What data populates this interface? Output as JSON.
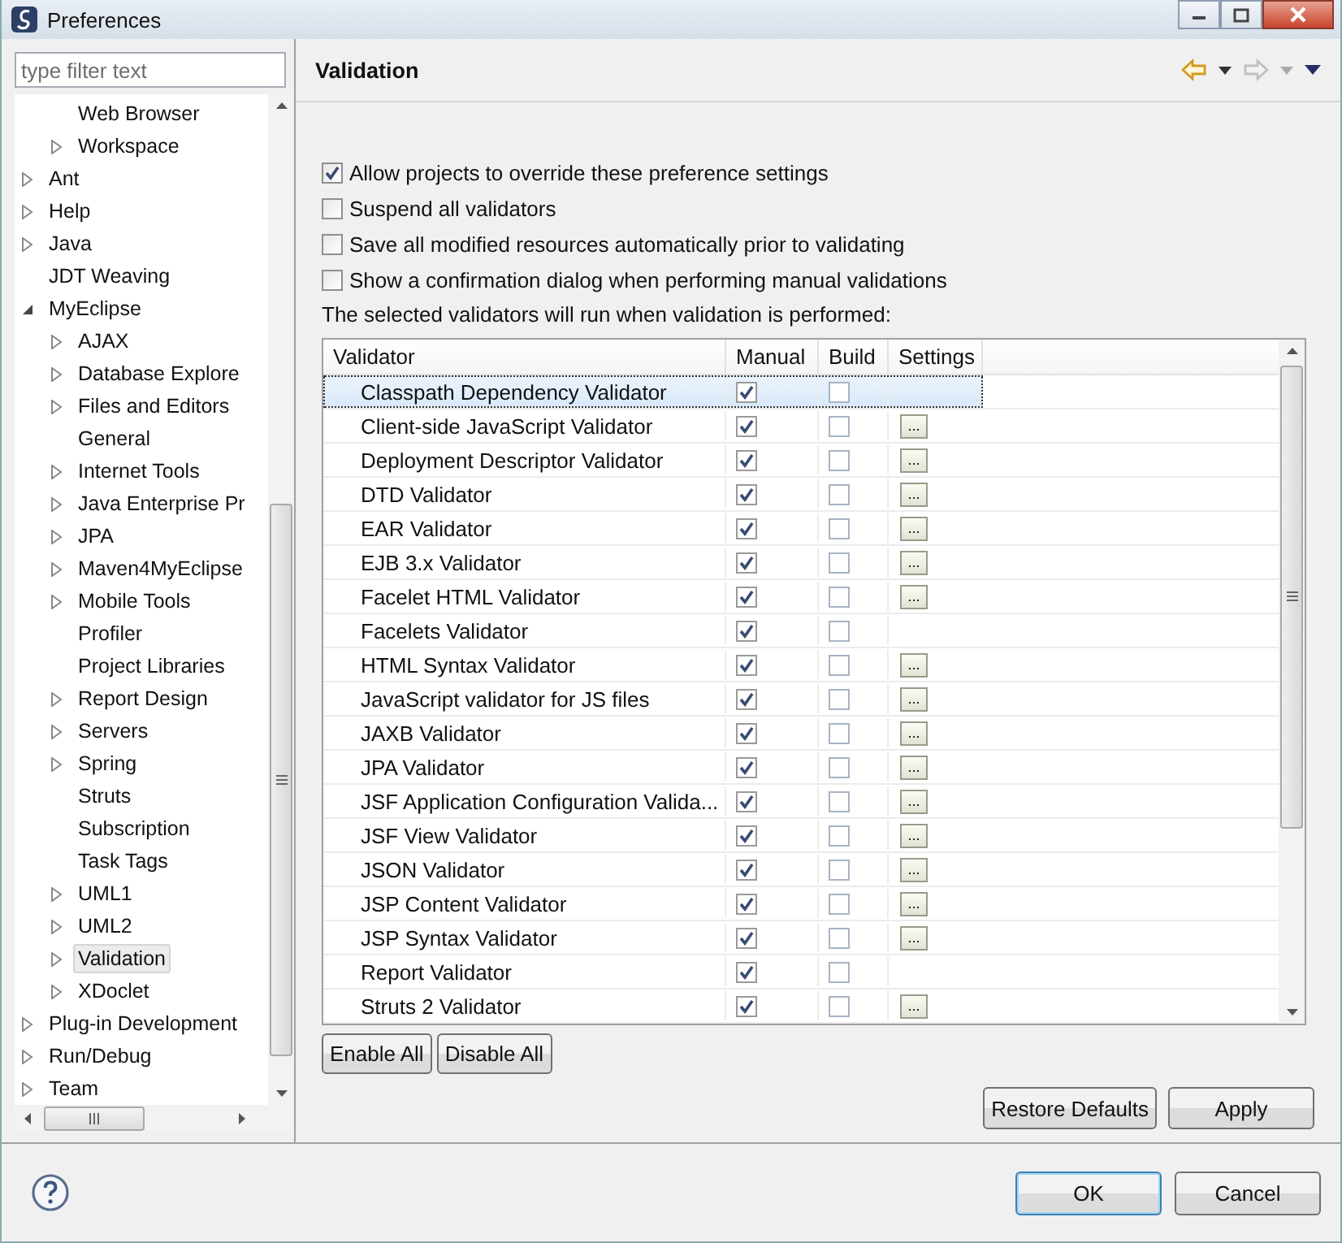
{
  "window": {
    "title": "Preferences"
  },
  "filter": {
    "placeholder": "type filter text"
  },
  "tree": {
    "partial_children": [
      {
        "label": "Web Browser",
        "selected": false
      },
      {
        "label": "Workspace",
        "expanded": false,
        "selected": false
      }
    ],
    "items": [
      {
        "label": "Ant",
        "expanded": false,
        "selected": false
      },
      {
        "label": "Help",
        "expanded": false,
        "selected": false
      },
      {
        "label": "Java",
        "expanded": false,
        "selected": false
      },
      {
        "label": "JDT Weaving",
        "selected": false
      },
      {
        "label": "MyEclipse",
        "expanded": true,
        "selected": false,
        "children": [
          {
            "label": "AJAX",
            "expanded": false,
            "selected": false
          },
          {
            "label": "Database Explore",
            "expanded": false,
            "selected": false
          },
          {
            "label": "Files and Editors",
            "expanded": false,
            "selected": false
          },
          {
            "label": "General",
            "selected": false
          },
          {
            "label": "Internet Tools",
            "expanded": false,
            "selected": false
          },
          {
            "label": "Java Enterprise Pr",
            "expanded": false,
            "selected": false
          },
          {
            "label": "JPA",
            "expanded": false,
            "selected": false
          },
          {
            "label": "Maven4MyEclipse",
            "expanded": false,
            "selected": false
          },
          {
            "label": "Mobile Tools",
            "expanded": false,
            "selected": false
          },
          {
            "label": "Profiler",
            "selected": false
          },
          {
            "label": "Project Libraries",
            "selected": false
          },
          {
            "label": "Report Design",
            "expanded": false,
            "selected": false
          },
          {
            "label": "Servers",
            "expanded": false,
            "selected": false
          },
          {
            "label": "Spring",
            "expanded": false,
            "selected": false
          },
          {
            "label": "Struts",
            "selected": false
          },
          {
            "label": "Subscription",
            "selected": false
          },
          {
            "label": "Task Tags",
            "selected": false
          },
          {
            "label": "UML1",
            "expanded": false,
            "selected": false
          },
          {
            "label": "UML2",
            "expanded": false,
            "selected": false
          },
          {
            "label": "Validation",
            "expanded": false,
            "selected": true
          },
          {
            "label": "XDoclet",
            "expanded": false,
            "selected": false
          }
        ]
      },
      {
        "label": "Plug-in Development",
        "expanded": false,
        "selected": false
      },
      {
        "label": "Run/Debug",
        "expanded": false,
        "selected": false
      },
      {
        "label": "Team",
        "expanded": false,
        "selected": false
      }
    ]
  },
  "page": {
    "title": "Validation"
  },
  "options": [
    {
      "label": "Allow projects to override these preference settings",
      "checked": true
    },
    {
      "label": "Suspend all validators",
      "checked": false
    },
    {
      "label": "Save all modified resources automatically prior to validating",
      "checked": false
    },
    {
      "label": "Show a confirmation dialog when performing manual validations",
      "checked": false
    }
  ],
  "note": "The selected validators will run when validation is performed:",
  "table": {
    "columns": [
      "Validator",
      "Manual",
      "Build",
      "Settings"
    ],
    "rows": [
      {
        "name": "Classpath Dependency Validator",
        "manual": true,
        "build": false,
        "selected": true
      },
      {
        "name": "Client-side JavaScript Validator",
        "manual": true,
        "build": false,
        "settings": "...",
        "selected": false
      },
      {
        "name": "Deployment Descriptor Validator",
        "manual": true,
        "build": false,
        "settings": "...",
        "selected": false
      },
      {
        "name": "DTD Validator",
        "manual": true,
        "build": false,
        "settings": "...",
        "selected": false
      },
      {
        "name": "EAR Validator",
        "manual": true,
        "build": false,
        "settings": "...",
        "selected": false
      },
      {
        "name": "EJB 3.x Validator",
        "manual": true,
        "build": false,
        "settings": "...",
        "selected": false
      },
      {
        "name": "Facelet HTML Validator",
        "manual": true,
        "build": false,
        "settings": "...",
        "selected": false
      },
      {
        "name": "Facelets Validator",
        "manual": true,
        "build": false,
        "selected": false
      },
      {
        "name": "HTML Syntax Validator",
        "manual": true,
        "build": false,
        "settings": "...",
        "selected": false
      },
      {
        "name": "JavaScript validator for JS files",
        "manual": true,
        "build": false,
        "settings": "...",
        "selected": false
      },
      {
        "name": "JAXB Validator",
        "manual": true,
        "build": false,
        "settings": "...",
        "selected": false
      },
      {
        "name": "JPA Validator",
        "manual": true,
        "build": false,
        "settings": "...",
        "selected": false
      },
      {
        "name": "JSF Application Configuration Valida...",
        "manual": true,
        "build": false,
        "settings": "...",
        "selected": false
      },
      {
        "name": "JSF View Validator",
        "manual": true,
        "build": false,
        "settings": "...",
        "selected": false
      },
      {
        "name": "JSON Validator",
        "manual": true,
        "build": false,
        "settings": "...",
        "selected": false
      },
      {
        "name": "JSP Content Validator",
        "manual": true,
        "build": false,
        "settings": "...",
        "selected": false
      },
      {
        "name": "JSP Syntax Validator",
        "manual": true,
        "build": false,
        "settings": "...",
        "selected": false
      },
      {
        "name": "Report Validator",
        "manual": true,
        "build": false,
        "selected": false
      },
      {
        "name": "Struts 2 Validator",
        "manual": true,
        "build": false,
        "settings": "...",
        "selected": false
      }
    ]
  },
  "table_buttons": [
    "Enable All",
    "Disable All"
  ],
  "page_buttons": [
    "Restore Defaults",
    "Apply"
  ],
  "dialog_buttons": [
    {
      "label": "OK",
      "default": true
    },
    {
      "label": "Cancel",
      "default": false
    }
  ]
}
